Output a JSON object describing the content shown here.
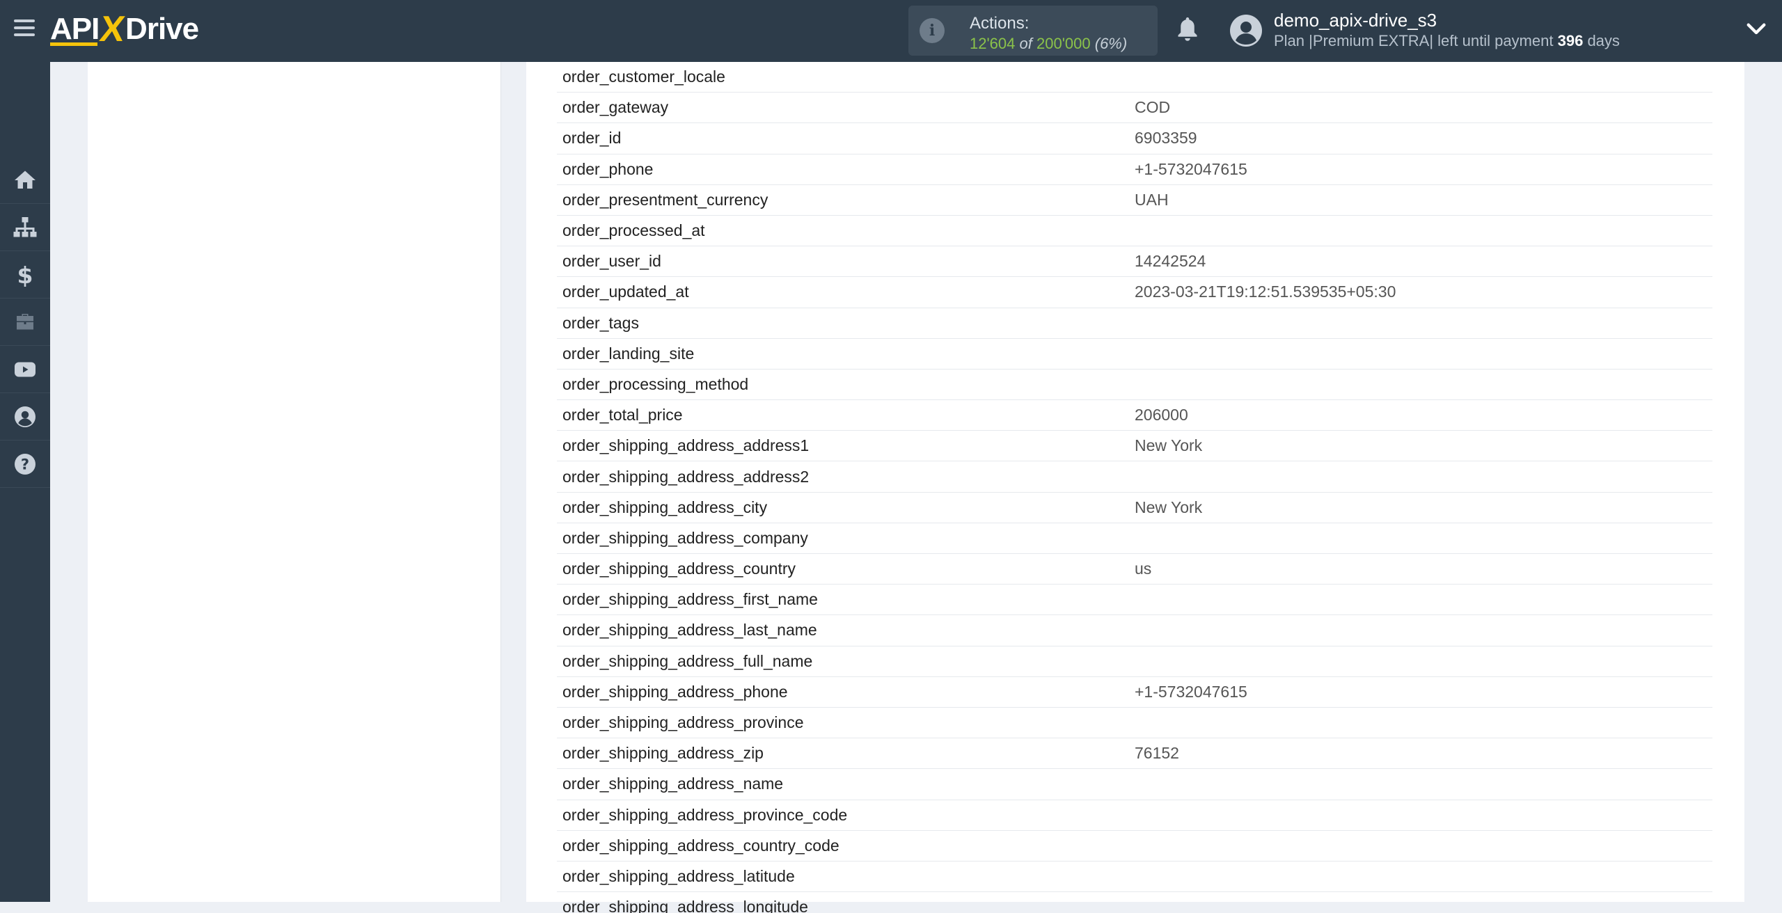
{
  "header": {
    "logo": {
      "pre": "API",
      "x": "X",
      "post": "Drive"
    },
    "actions": {
      "label": "Actions:",
      "used": "12'604",
      "of": "of",
      "total": "200'000",
      "percent": "(6%)"
    },
    "user": {
      "name": "demo_apix-drive_s3",
      "plan_prefix": "Plan |Premium EXTRA| left until payment",
      "days": "396",
      "days_suffix": "days"
    }
  },
  "sidebar": {
    "items": [
      {
        "icon": "home-icon"
      },
      {
        "icon": "sitemap-icon"
      },
      {
        "icon": "dollar-icon"
      },
      {
        "icon": "briefcase-icon"
      },
      {
        "icon": "youtube-icon"
      },
      {
        "icon": "user-circle-icon"
      },
      {
        "icon": "question-circle-icon"
      }
    ]
  },
  "fields": [
    {
      "key": "order_customer_locale",
      "value": ""
    },
    {
      "key": "order_gateway",
      "value": "COD"
    },
    {
      "key": "order_id",
      "value": "6903359"
    },
    {
      "key": "order_phone",
      "value": "+1-5732047615"
    },
    {
      "key": "order_presentment_currency",
      "value": "UAH"
    },
    {
      "key": "order_processed_at",
      "value": ""
    },
    {
      "key": "order_user_id",
      "value": "14242524"
    },
    {
      "key": "order_updated_at",
      "value": "2023-03-21T19:12:51.539535+05:30"
    },
    {
      "key": "order_tags",
      "value": ""
    },
    {
      "key": "order_landing_site",
      "value": ""
    },
    {
      "key": "order_processing_method",
      "value": ""
    },
    {
      "key": "order_total_price",
      "value": "206000"
    },
    {
      "key": "order_shipping_address_address1",
      "value": "New York"
    },
    {
      "key": "order_shipping_address_address2",
      "value": ""
    },
    {
      "key": "order_shipping_address_city",
      "value": "New York"
    },
    {
      "key": "order_shipping_address_company",
      "value": ""
    },
    {
      "key": "order_shipping_address_country",
      "value": "us"
    },
    {
      "key": "order_shipping_address_first_name",
      "value": ""
    },
    {
      "key": "order_shipping_address_last_name",
      "value": ""
    },
    {
      "key": "order_shipping_address_full_name",
      "value": ""
    },
    {
      "key": "order_shipping_address_phone",
      "value": "+1-5732047615"
    },
    {
      "key": "order_shipping_address_province",
      "value": ""
    },
    {
      "key": "order_shipping_address_zip",
      "value": "76152"
    },
    {
      "key": "order_shipping_address_name",
      "value": ""
    },
    {
      "key": "order_shipping_address_province_code",
      "value": ""
    },
    {
      "key": "order_shipping_address_country_code",
      "value": ""
    },
    {
      "key": "order_shipping_address_latitude",
      "value": ""
    },
    {
      "key": "order_shipping_address_longitude",
      "value": ""
    }
  ],
  "colors": {
    "header_bg": "#2d3c4a",
    "accent_yellow": "#f5c30b",
    "actions_green": "#8bc34a"
  }
}
